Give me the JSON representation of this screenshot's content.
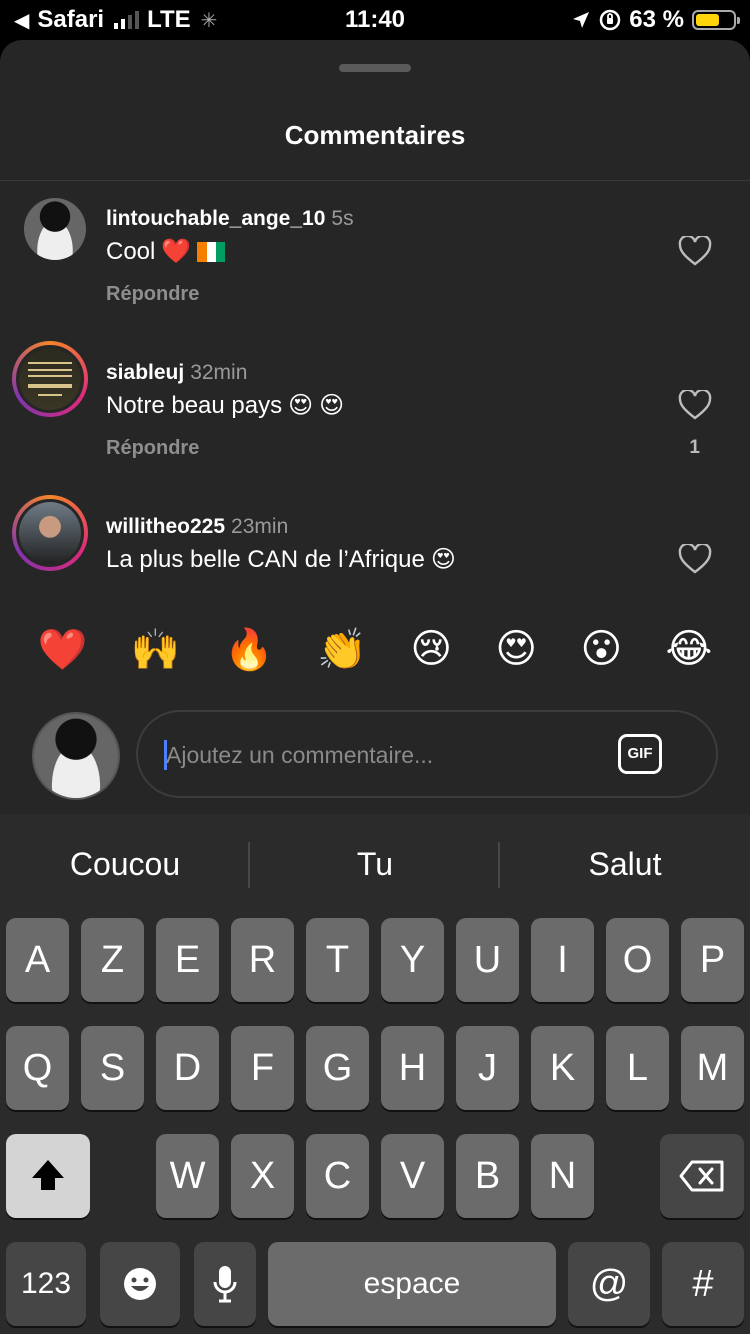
{
  "status_bar": {
    "back_app": "Safari",
    "network": "LTE",
    "time": "11:40",
    "battery_percent": "63 %",
    "battery_level": 0.63
  },
  "sheet": {
    "title": "Commentaires"
  },
  "comments": [
    {
      "username": "lintouchable_ange_10",
      "time": "5s",
      "text": "Cool",
      "emoji": [
        "red-heart",
        "ivory-coast-flag"
      ],
      "reply_label": "Répondre",
      "like_count": ""
    },
    {
      "username": "siableuj",
      "time": "32min",
      "text": "Notre beau pays",
      "emoji": [
        "heart-eyes",
        "heart-eyes"
      ],
      "reply_label": "Répondre",
      "like_count": "1"
    },
    {
      "username": "willitheo225",
      "time": "23min",
      "text": "La plus belle CAN de l’Afrique",
      "emoji": [
        "heart-eyes"
      ],
      "reply_label": "",
      "like_count": ""
    }
  ],
  "emoji_bar": [
    "❤️",
    "🙌",
    "🔥",
    "👏",
    "😢",
    "😍",
    "😮",
    "😂"
  ],
  "input": {
    "placeholder": "Ajoutez un commentaire...",
    "gif_label": "GIF"
  },
  "keyboard": {
    "suggestions": [
      "Coucou",
      "Tu",
      "Salut"
    ],
    "row1": [
      "A",
      "Z",
      "E",
      "R",
      "T",
      "Y",
      "U",
      "I",
      "O",
      "P"
    ],
    "row2": [
      "Q",
      "S",
      "D",
      "F",
      "G",
      "H",
      "J",
      "K",
      "L",
      "M"
    ],
    "row3": [
      "W",
      "X",
      "C",
      "V",
      "B",
      "N"
    ],
    "numbers_label": "123",
    "space_label": "espace",
    "at_label": "@",
    "hash_label": "#"
  },
  "colors": {
    "sheet_bg": "#262626",
    "battery": "#ffd60a",
    "heart_red": "#e0245e",
    "caret_blue": "#4c80ff"
  }
}
